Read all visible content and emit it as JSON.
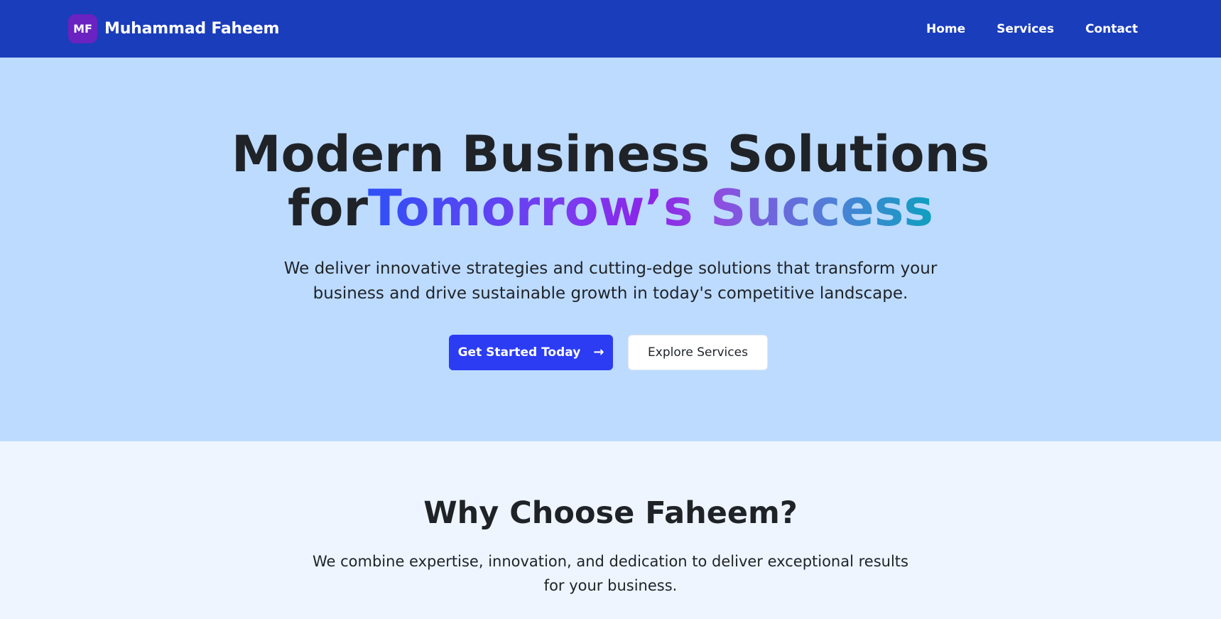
{
  "brand": {
    "badge": "MF",
    "name": "Muhammad Faheem"
  },
  "nav": {
    "items": [
      {
        "label": "Home"
      },
      {
        "label": "Services"
      },
      {
        "label": "Contact"
      }
    ]
  },
  "hero": {
    "title_line1": "Modern Business Solutions",
    "title_line2_plain": "for",
    "title_line2_gradient": "Tomorrow’s Success",
    "subtitle": "We deliver innovative strategies and cutting-edge solutions that transform your business and drive sustainable growth in today's competitive landscape.",
    "primary_button": "Get Started Today",
    "primary_icon": "arrow-right-icon",
    "secondary_button": "Explore Services"
  },
  "why": {
    "title": "Why Choose Faheem?",
    "subtitle": "We combine expertise, innovation, and dedication to deliver exceptional results for your business."
  },
  "colors": {
    "navbar": "#1a3dbb",
    "hero_bg": "#bddbff",
    "section_bg": "#eef5ff",
    "primary": "#2b3cf3",
    "badge": "#6a22c0"
  }
}
